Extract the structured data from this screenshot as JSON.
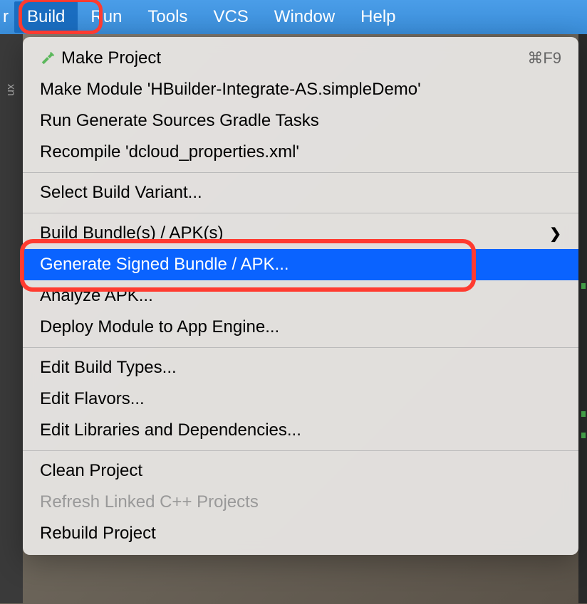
{
  "menubar": {
    "leftChar": "r",
    "items": [
      "Build",
      "Run",
      "Tools",
      "VCS",
      "Window",
      "Help"
    ],
    "activeIndex": 0
  },
  "dropdown": {
    "groups": [
      [
        {
          "label": "Make Project",
          "icon": "hammer",
          "shortcut": "⌘F9",
          "selected": false,
          "disabled": false,
          "submenu": false
        },
        {
          "label": "Make Module 'HBuilder-Integrate-AS.simpleDemo'",
          "selected": false,
          "disabled": false,
          "submenu": false
        },
        {
          "label": "Run Generate Sources Gradle Tasks",
          "selected": false,
          "disabled": false,
          "submenu": false
        },
        {
          "label": "Recompile 'dcloud_properties.xml'",
          "selected": false,
          "disabled": false,
          "submenu": false
        }
      ],
      [
        {
          "label": "Select Build Variant...",
          "selected": false,
          "disabled": false,
          "submenu": false
        }
      ],
      [
        {
          "label": "Build Bundle(s) / APK(s)",
          "selected": false,
          "disabled": false,
          "submenu": true
        },
        {
          "label": "Generate Signed Bundle / APK...",
          "selected": true,
          "disabled": false,
          "submenu": false
        },
        {
          "label": "Analyze APK...",
          "selected": false,
          "disabled": false,
          "submenu": false
        },
        {
          "label": "Deploy Module to App Engine...",
          "selected": false,
          "disabled": false,
          "submenu": false
        }
      ],
      [
        {
          "label": "Edit Build Types...",
          "selected": false,
          "disabled": false,
          "submenu": false
        },
        {
          "label": "Edit Flavors...",
          "selected": false,
          "disabled": false,
          "submenu": false
        },
        {
          "label": "Edit Libraries and Dependencies...",
          "selected": false,
          "disabled": false,
          "submenu": false
        }
      ],
      [
        {
          "label": "Clean Project",
          "selected": false,
          "disabled": false,
          "submenu": false
        },
        {
          "label": "Refresh Linked C++ Projects",
          "selected": false,
          "disabled": true,
          "submenu": false
        },
        {
          "label": "Rebuild Project",
          "selected": false,
          "disabled": false,
          "submenu": false
        }
      ]
    ]
  },
  "sidebar": {
    "text": "xn"
  }
}
